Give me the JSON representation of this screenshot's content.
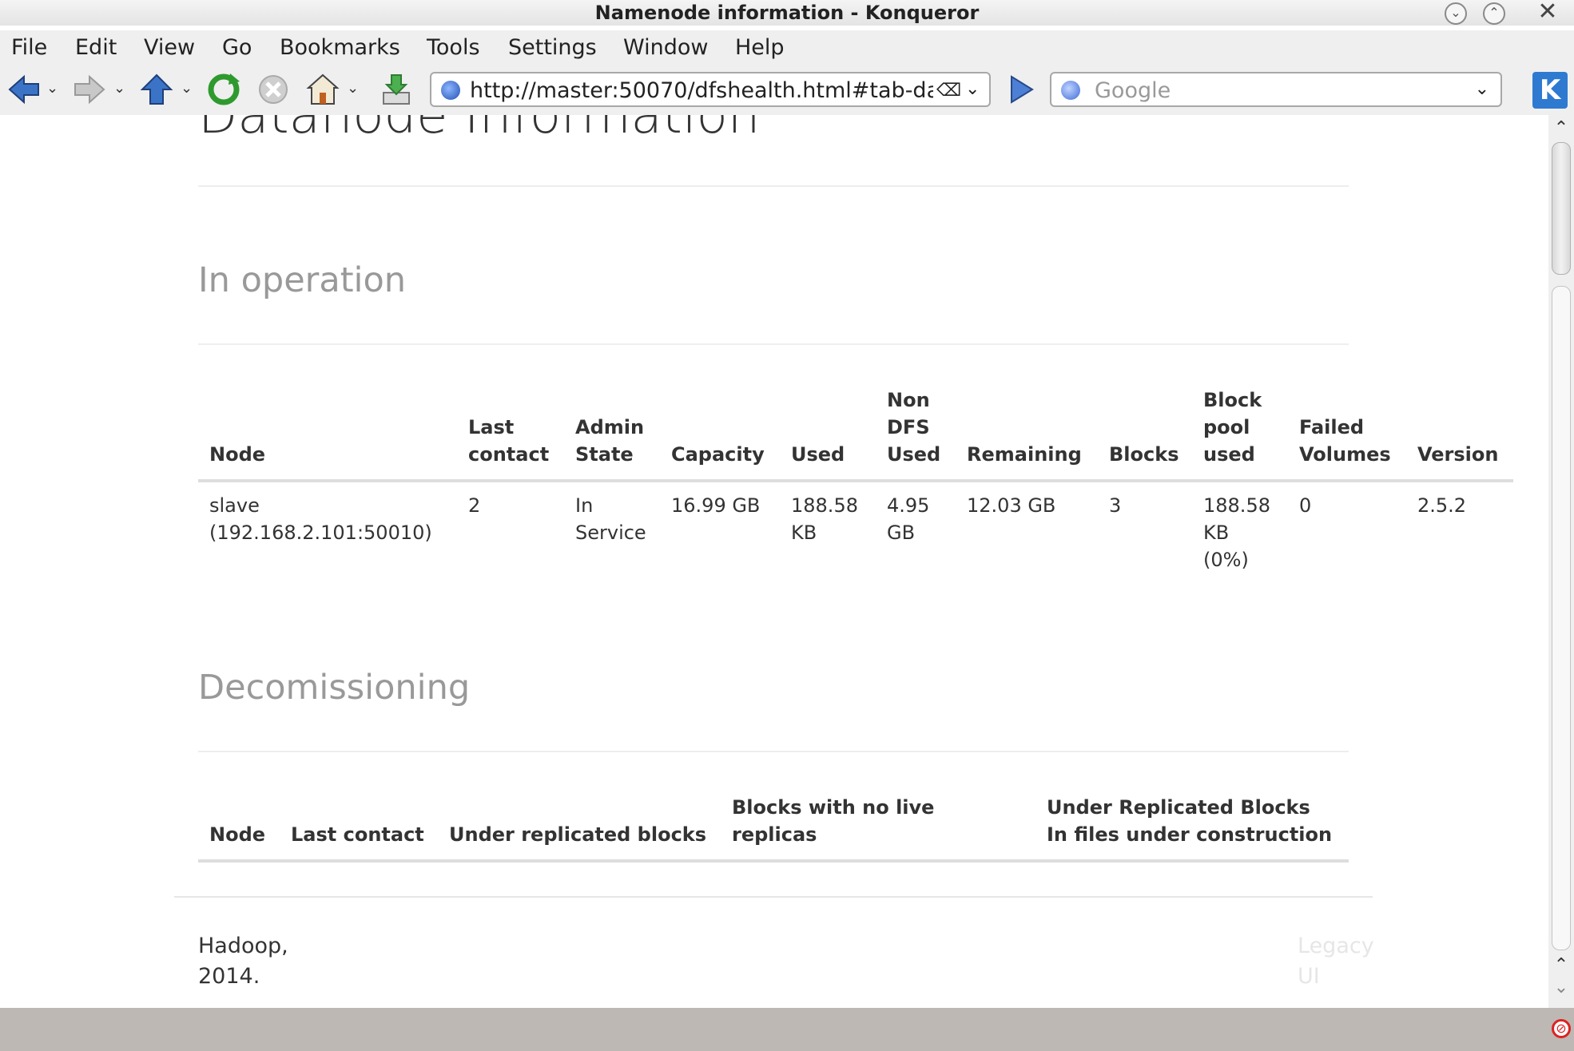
{
  "window": {
    "title": "Namenode information - Konqueror"
  },
  "menu": [
    "File",
    "Edit",
    "View",
    "Go",
    "Bookmarks",
    "Tools",
    "Settings",
    "Window",
    "Help"
  ],
  "toolbar": {
    "url": "http://master:50070/dfshealth.html#tab-da",
    "search_placeholder": "Google"
  },
  "page": {
    "heading": "Datanode Information",
    "in_operation_title": "In operation",
    "decommissioning_title": "Decomissioning",
    "in_operation_table": {
      "headers": [
        "Node",
        "Last contact",
        "Admin State",
        "Capacity",
        "Used",
        "Non DFS Used",
        "Remaining",
        "Blocks",
        "Block pool used",
        "Failed Volumes",
        "Version"
      ],
      "rows": [
        [
          "slave (192.168.2.101:50010)",
          "2",
          "In Service",
          "16.99 GB",
          "188.58 KB",
          "4.95 GB",
          "12.03 GB",
          "3",
          "188.58 KB (0%)",
          "0",
          "2.5.2"
        ]
      ]
    },
    "decommissioning_table": {
      "headers": [
        "Node",
        "Last contact",
        "Under replicated blocks",
        "Blocks with no live replicas",
        "Under Replicated Blocks In files under construction"
      ]
    },
    "footer": {
      "left": "Hadoop, 2014.",
      "right": "Legacy UI"
    }
  },
  "colors": {
    "heading": "#333333",
    "section_title": "#999999",
    "footer_link": "#e6e6e6",
    "statusbar": "#bdb8b3"
  }
}
